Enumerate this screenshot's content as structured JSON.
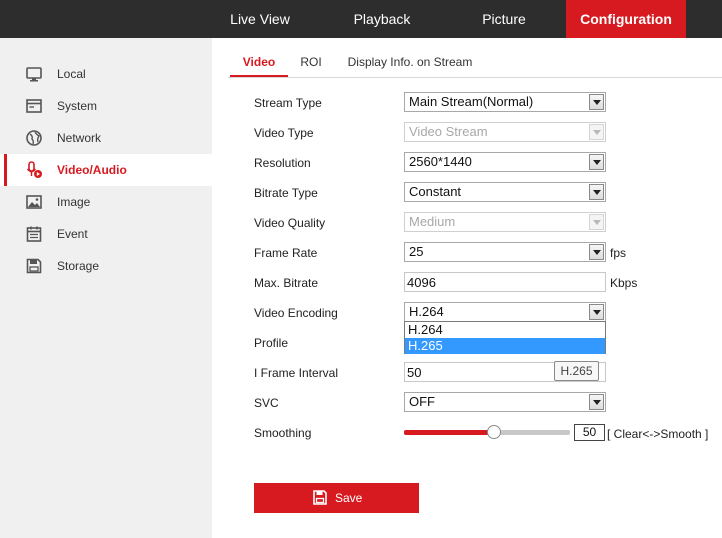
{
  "topnav": {
    "items": [
      {
        "label": "Live View"
      },
      {
        "label": "Playback"
      },
      {
        "label": "Picture"
      },
      {
        "label": "Configuration",
        "active": true
      }
    ]
  },
  "sidebar": {
    "items": [
      {
        "label": "Local",
        "icon": "monitor-icon"
      },
      {
        "label": "System",
        "icon": "system-icon"
      },
      {
        "label": "Network",
        "icon": "globe-icon"
      },
      {
        "label": "Video/Audio",
        "icon": "video-audio-icon",
        "active": true
      },
      {
        "label": "Image",
        "icon": "image-icon"
      },
      {
        "label": "Event",
        "icon": "calendar-icon"
      },
      {
        "label": "Storage",
        "icon": "storage-icon"
      }
    ]
  },
  "tabs": [
    {
      "label": "Video",
      "active": true
    },
    {
      "label": "ROI"
    },
    {
      "label": "Display Info. on Stream"
    }
  ],
  "form": {
    "stream_type": {
      "label": "Stream Type",
      "value": "Main Stream(Normal)"
    },
    "video_type": {
      "label": "Video Type",
      "value": "Video Stream",
      "disabled": true
    },
    "resolution": {
      "label": "Resolution",
      "value": "2560*1440"
    },
    "bitrate_type": {
      "label": "Bitrate Type",
      "value": "Constant"
    },
    "video_quality": {
      "label": "Video Quality",
      "value": "Medium",
      "disabled": true
    },
    "frame_rate": {
      "label": "Frame Rate",
      "value": "25",
      "unit": "fps"
    },
    "max_bitrate": {
      "label": "Max. Bitrate",
      "value": "4096",
      "unit": "Kbps"
    },
    "video_encoding": {
      "label": "Video Encoding",
      "value": "H.264",
      "options": [
        "H.264",
        "H.265"
      ],
      "highlighted_option": "H.265"
    },
    "profile": {
      "label": "Profile"
    },
    "i_frame_interval": {
      "label": "I Frame Interval",
      "value": "50"
    },
    "svc": {
      "label": "SVC",
      "value": "OFF"
    },
    "smoothing": {
      "label": "Smoothing",
      "value": "50",
      "level_percent": 50,
      "hint": "[ Clear<->Smooth ]"
    }
  },
  "tooltip": {
    "text": "H.265"
  },
  "save_button": {
    "label": "Save"
  },
  "colors": {
    "accent": "#d71920",
    "topbar": "#2d2d2d",
    "sidebar": "#f0f0f0",
    "highlight": "#3399ff"
  }
}
